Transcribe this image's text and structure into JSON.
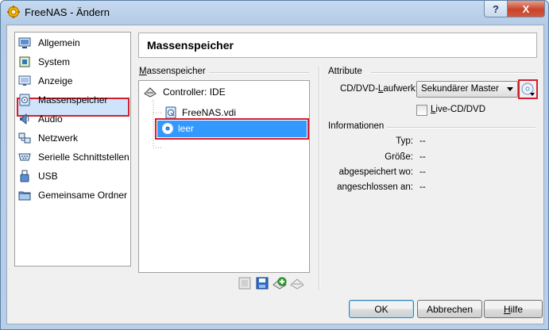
{
  "window": {
    "title": "FreeNAS - Ändern",
    "help_glyph": "?",
    "close_glyph": "X"
  },
  "nav": {
    "items": [
      {
        "label": "Allgemein",
        "icon": "general-icon"
      },
      {
        "label": "System",
        "icon": "system-icon"
      },
      {
        "label": "Anzeige",
        "icon": "display-icon"
      },
      {
        "label": "Massenspeicher",
        "icon": "storage-icon",
        "selected": true
      },
      {
        "label": "Audio",
        "icon": "audio-icon"
      },
      {
        "label": "Netzwerk",
        "icon": "network-icon"
      },
      {
        "label": "Serielle Schnittstellen",
        "icon": "serial-port-icon"
      },
      {
        "label": "USB",
        "icon": "usb-icon"
      },
      {
        "label": "Gemeinsame Ordner",
        "icon": "shared-folder-icon"
      }
    ]
  },
  "header": {
    "title": "Massenspeicher"
  },
  "storage": {
    "group_label_pre": "",
    "group_label_u": "M",
    "group_label_post": "assenspeicher",
    "tree": {
      "controller": "Controller: IDE",
      "disk": "FreeNAS.vdi",
      "optical": "leer"
    }
  },
  "attributes": {
    "group_label": "Attribute",
    "drive_label_pre": "CD/DVD-",
    "drive_label_u": "L",
    "drive_label_post": "aufwerk:",
    "drive_value": "Sekundärer Master",
    "live_cd_pre": "",
    "live_cd_u": "L",
    "live_cd_post": "ive-CD/DVD",
    "live_cd_checked": false
  },
  "info": {
    "group_label": "Informationen",
    "rows": [
      {
        "label": "Typ:",
        "value": "--"
      },
      {
        "label": "Größe:",
        "value": "--"
      },
      {
        "label": "abgespeichert wo:",
        "value": "--"
      },
      {
        "label": "angeschlossen an:",
        "value": "--"
      }
    ]
  },
  "buttons": {
    "ok": "OK",
    "cancel": "Abbrechen",
    "help_u": "H",
    "help_post": "ilfe"
  },
  "colors": {
    "highlight_frame": "#d31f2d",
    "selection": "#3399ff",
    "title_gradient_top": "#c5d9ef"
  }
}
